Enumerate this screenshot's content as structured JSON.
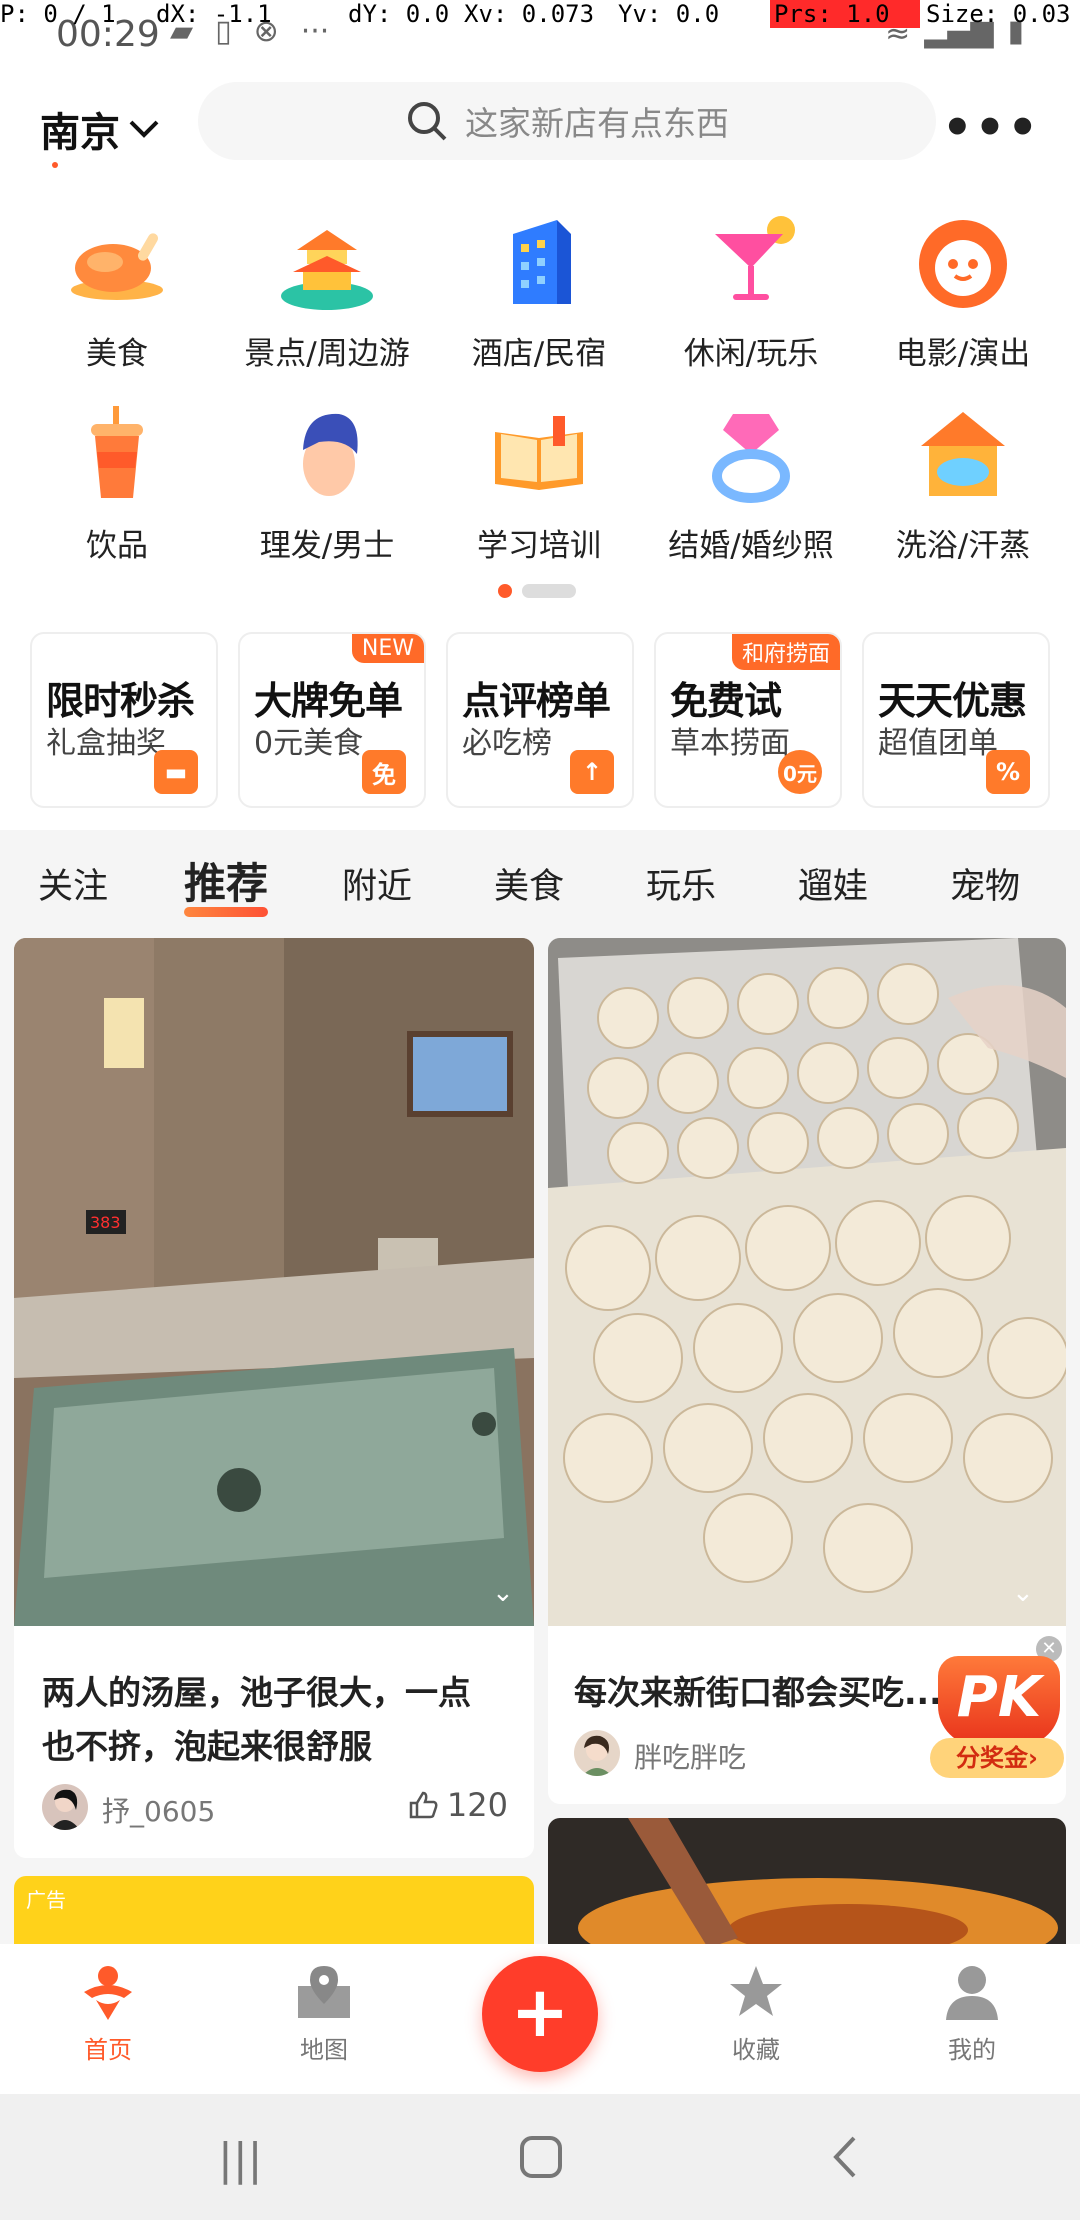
{
  "debug": {
    "p": "P: 0 / 1",
    "dx": "dX: -1.1",
    "dy": "dY: 0.0",
    "xv": "Xv: 0.073",
    "yv": "Yv: 0.0",
    "prs": "Prs: 1.0",
    "size": "Size: 0.03"
  },
  "status": {
    "time": "00:29",
    "dots": "···"
  },
  "header": {
    "city": "南京",
    "search_placeholder": "这家新店有点东西"
  },
  "categories": [
    {
      "label": "美食",
      "icon": "roast-chicken-icon"
    },
    {
      "label": "景点/周边游",
      "icon": "pagoda-icon"
    },
    {
      "label": "酒店/民宿",
      "icon": "hotel-building-icon"
    },
    {
      "label": "休闲/玩乐",
      "icon": "cocktail-icon"
    },
    {
      "label": "电影/演出",
      "icon": "cat-mascot-icon"
    },
    {
      "label": "饮品",
      "icon": "drink-cup-icon"
    },
    {
      "label": "理发/男士",
      "icon": "man-haircut-icon"
    },
    {
      "label": "学习培训",
      "icon": "open-book-icon"
    },
    {
      "label": "结婚/婚纱照",
      "icon": "diamond-ring-icon"
    },
    {
      "label": "洗浴/汗蒸",
      "icon": "bath-pool-icon"
    }
  ],
  "promos": [
    {
      "title": "限时秒杀",
      "sub": "礼盒抽奖",
      "badge": "",
      "tag": ""
    },
    {
      "title": "大牌免单",
      "sub": "0元美食",
      "badge": "NEW",
      "tag": "免"
    },
    {
      "title": "点评榜单",
      "sub": "必吃榜",
      "badge": "",
      "tag": "↑"
    },
    {
      "title": "免费试",
      "sub": "草本捞面",
      "badge": "和府捞面",
      "tag": "0元"
    },
    {
      "title": "天天优惠",
      "sub": "超值团单",
      "badge": "",
      "tag": "%"
    }
  ],
  "tabs": [
    "关注",
    "推荐",
    "附近",
    "美食",
    "玩乐",
    "遛娃",
    "宠物"
  ],
  "feed": {
    "left": {
      "title_line1": "两人的汤屋，池子很大，一点",
      "title_line2": "也不挤，泡起来很舒服",
      "author": "抒_0605",
      "likes": "120",
      "thermo": "383"
    },
    "right": {
      "title": "每次来新街口都会买吃...",
      "author": "胖吃胖吃"
    },
    "ad_label": "广告",
    "pk": {
      "text": "PK",
      "bonus": "分奖金›"
    }
  },
  "bottom_nav": [
    {
      "label": "首页",
      "icon": "home-mascot-icon"
    },
    {
      "label": "地图",
      "icon": "map-pin-icon"
    },
    {
      "label": "收藏",
      "icon": "star-icon"
    },
    {
      "label": "我的",
      "icon": "user-icon"
    }
  ],
  "fab_label": "+",
  "colors": {
    "accent": "#ff5a2a",
    "fab": "#ff3d2a",
    "promo_yellow": "#ffd21a"
  }
}
